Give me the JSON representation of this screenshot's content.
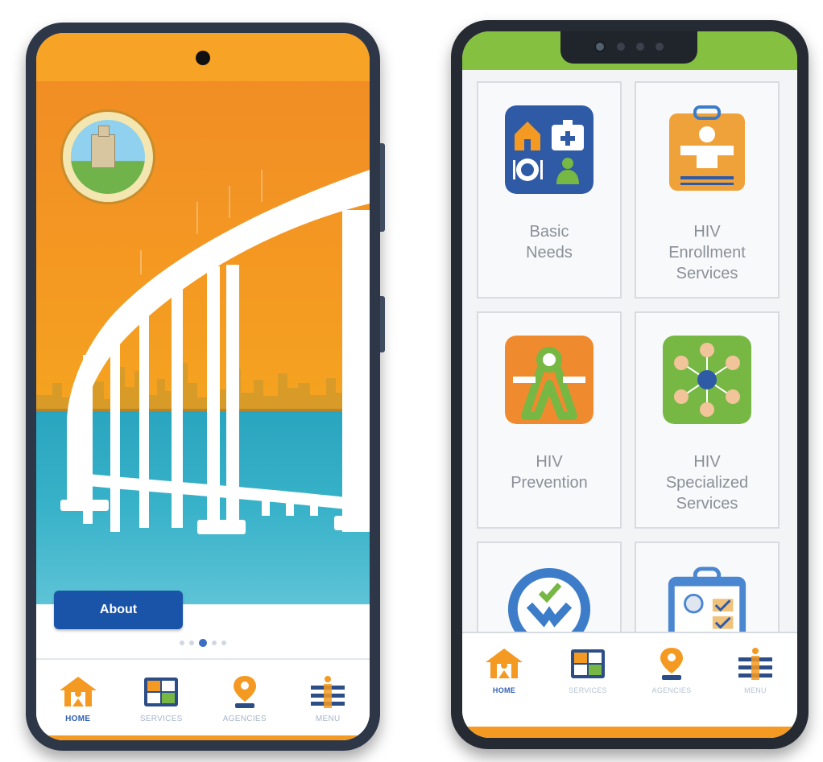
{
  "left_phone": {
    "about_button": "About",
    "carousel": {
      "count": 5,
      "active": 2
    },
    "tabs": [
      {
        "label": "HOME",
        "icon": "house-icon",
        "active": true
      },
      {
        "label": "SERVICES",
        "icon": "services-icon",
        "active": false
      },
      {
        "label": "AGENCIES",
        "icon": "map-pin-icon",
        "active": false
      },
      {
        "label": "MENU",
        "icon": "menu-icon",
        "active": false
      }
    ]
  },
  "right_phone": {
    "cards": [
      {
        "label": "Basic\nNeeds",
        "icon": "basic-needs-icon",
        "color": "#2f5aa5"
      },
      {
        "label": "HIV\nEnrollment\nServices",
        "icon": "clipboard-person-icon",
        "color": "#f0a23a"
      },
      {
        "label": "HIV\nPrevention",
        "icon": "ribbon-person-icon",
        "color": "#f08a2e"
      },
      {
        "label": "HIV\nSpecialized\nServices",
        "icon": "network-people-icon",
        "color": "#76b843"
      },
      {
        "label": "",
        "icon": "check-person-icon",
        "color": "#3d7cc9"
      },
      {
        "label": "",
        "icon": "clipboard-checklist-icon",
        "color": "#4b86d1"
      }
    ],
    "tabs": [
      {
        "label": "HOME",
        "icon": "house-icon",
        "active": true
      },
      {
        "label": "SERVICES",
        "icon": "services-icon",
        "active": false
      },
      {
        "label": "AGENCIES",
        "icon": "map-pin-icon",
        "active": false
      },
      {
        "label": "MENU",
        "icon": "menu-icon",
        "active": false
      }
    ]
  },
  "colors": {
    "orange": "#f49a22",
    "blue": "#1a54a8",
    "green": "#86c041",
    "teal": "#38b2c9"
  }
}
